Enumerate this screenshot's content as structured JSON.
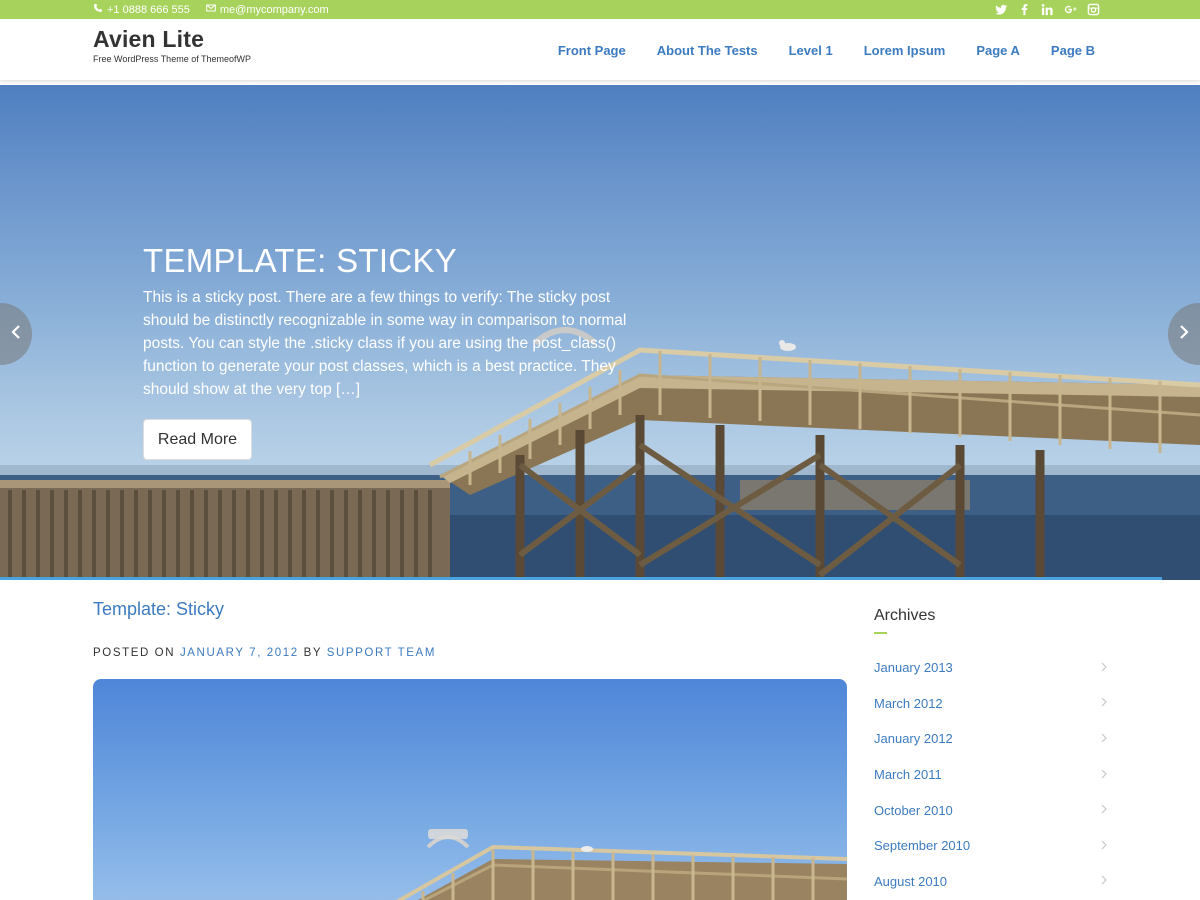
{
  "topbar": {
    "phone": "+1 0888 666 555",
    "email": "me@mycompany.com",
    "social_icons": [
      "twitter-icon",
      "facebook-icon",
      "linkedin-icon",
      "google-plus-icon",
      "instagram-icon"
    ],
    "color": "#a7d25c"
  },
  "header": {
    "site_title": "Avien Lite",
    "tagline": "Free WordPress Theme of ThemeofWP",
    "nav": [
      "Front Page",
      "About The Tests",
      "Level 1",
      "Lorem Ipsum",
      "Page A",
      "Page B"
    ],
    "nav_color": "#3c7bbf"
  },
  "slider": {
    "title": "TEMPLATE: STICKY",
    "text": "This is a sticky post. There are a few things to verify: The sticky post should be distinctly recognizable in some way in comparison to normal posts. You can style the .sticky class if you are using the post_class() function to generate your post classes, which is a best practice. They should show at the very top […]",
    "button_label": "Read More",
    "prev_icon": "chevron-left-icon",
    "next_icon": "chevron-right-icon",
    "accent": "#4aa3df"
  },
  "post": {
    "title": "Template: Sticky",
    "meta_posted_on": "POSTED ON",
    "meta_date": "JANUARY 7, 2012",
    "meta_by": "BY",
    "meta_author": "SUPPORT TEAM"
  },
  "sidebar": {
    "archives_title": "Archives",
    "archives": [
      "January 2013",
      "March 2012",
      "January 2012",
      "March 2011",
      "October 2010",
      "September 2010",
      "August 2010"
    ]
  }
}
